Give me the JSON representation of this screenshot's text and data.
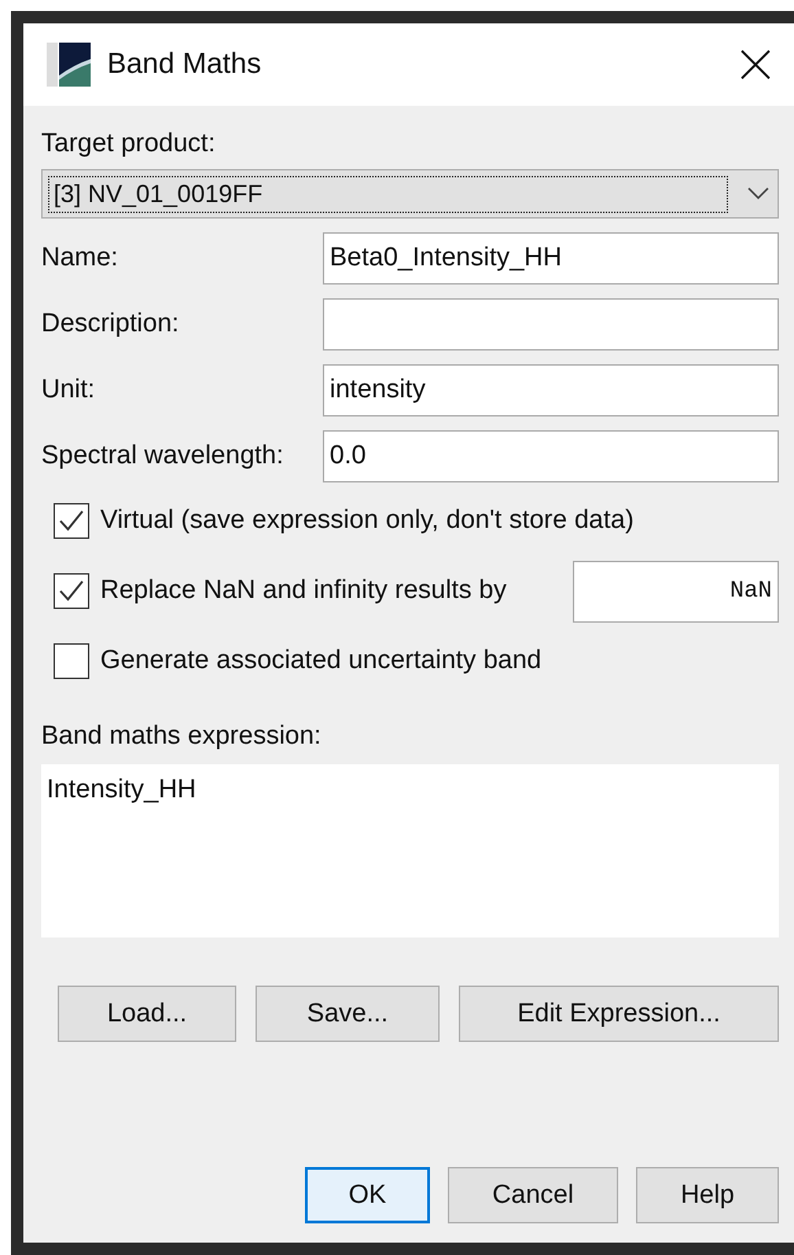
{
  "window": {
    "title": "Band Maths"
  },
  "target_product": {
    "label": "Target product:",
    "value": "[3] NV_01_0019FF"
  },
  "fields": [
    {
      "label": "Name:",
      "value": "Beta0_Intensity_HH"
    },
    {
      "label": "Description:"
    },
    {
      "label": "Unit:",
      "value": "intensity"
    },
    {
      "label": "Spectral wavelength:",
      "value": "0.0"
    }
  ],
  "checkboxes": [
    {
      "kind": "plain",
      "label": "Virtual (save expression only, don't store data)",
      "checked": true
    },
    {
      "kind": "with-field",
      "label": "Replace NaN and infinity results by",
      "checked": true,
      "value": "NaN"
    },
    {
      "kind": "plain",
      "label": "Generate associated uncertainty band",
      "checked": false
    }
  ],
  "expression": {
    "label": "Band maths expression:",
    "value": "Intensity_HH"
  },
  "expression_buttons": [
    "Load...",
    "Save...",
    "Edit Expression..."
  ],
  "dialog_buttons": [
    {
      "label": "OK",
      "focused": true
    },
    {
      "label": "Cancel",
      "focused": false
    },
    {
      "label": "Help",
      "focused": false
    }
  ]
}
